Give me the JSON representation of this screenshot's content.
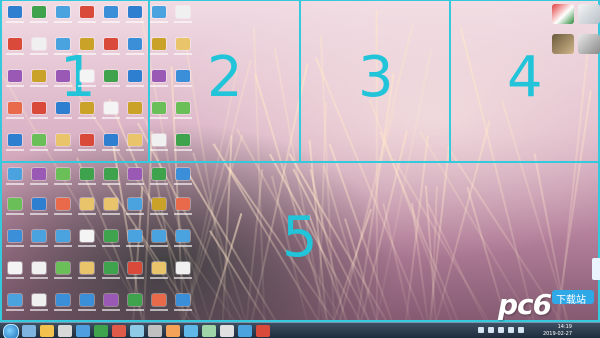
{
  "zones": [
    {
      "label": "1"
    },
    {
      "label": "2"
    },
    {
      "label": "3"
    },
    {
      "label": "4"
    },
    {
      "label": "5"
    }
  ],
  "taskbar": {
    "time": "14:19",
    "date": "2019-02-27"
  },
  "watermark": {
    "logo": "pc6",
    "label": "下载站"
  },
  "colors": {
    "grid": "#35c9dd",
    "zone_number": "#21c4d8",
    "taskbar": "#1c2b3a"
  }
}
